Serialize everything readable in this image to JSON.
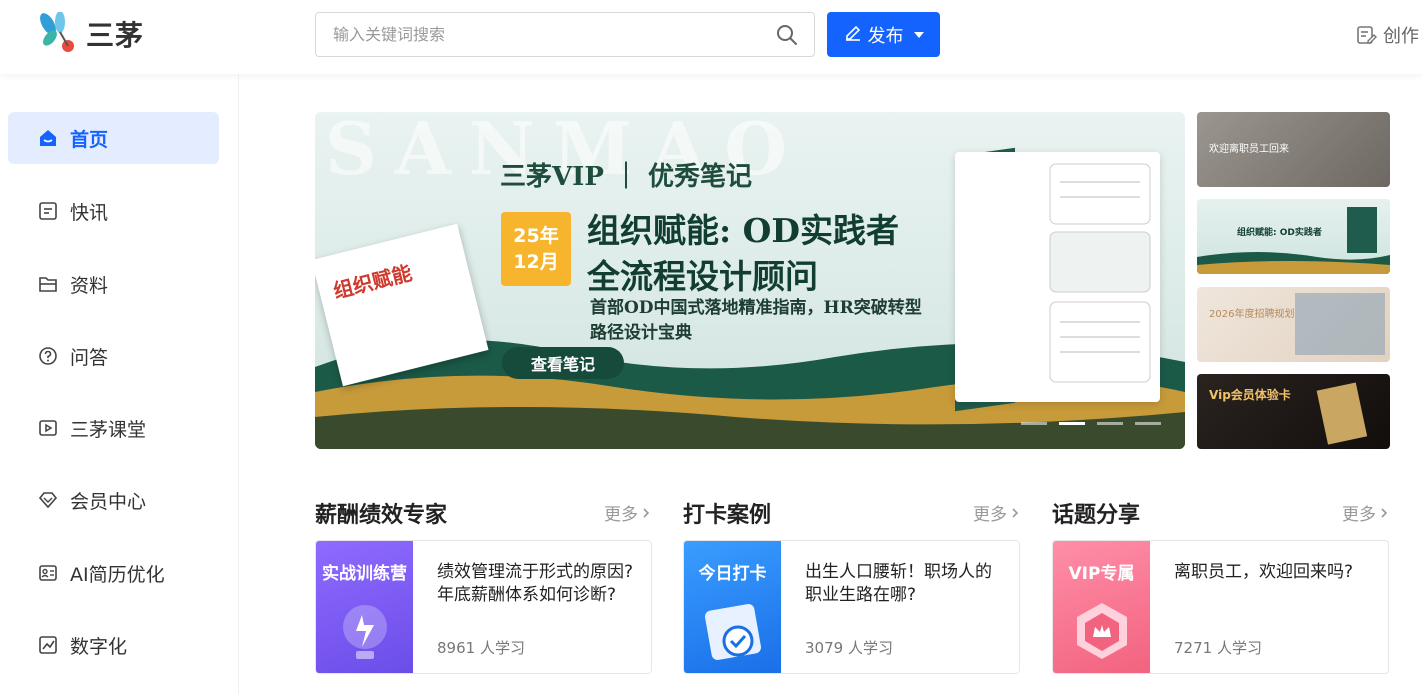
{
  "header": {
    "logo_text": "三茅",
    "search_placeholder": "输入关键词搜索",
    "publish_label": "发布",
    "create_label": "创作"
  },
  "sidebar": {
    "items": [
      {
        "label": "首页",
        "icon": "home-icon",
        "active": true
      },
      {
        "label": "快讯",
        "icon": "news-icon"
      },
      {
        "label": "资料",
        "icon": "folder-icon"
      },
      {
        "label": "问答",
        "icon": "question-icon"
      },
      {
        "label": "三茅课堂",
        "icon": "play-icon"
      },
      {
        "label": "会员中心",
        "icon": "diamond-icon"
      },
      {
        "label": "AI简历优化",
        "icon": "resume-icon"
      },
      {
        "label": "数字化",
        "icon": "chart-icon"
      }
    ]
  },
  "banner": {
    "subtitle": "三茅VIP ｜ 优秀笔记",
    "badge_year": "25年",
    "badge_month": "12月",
    "title_line1": "组织赋能: OD实践者",
    "title_line2": "全流程设计顾问",
    "desc_line1": "首部OD中国式落地精准指南，HR突破转型",
    "desc_line2": "路径设计宝典",
    "button": "查看笔记",
    "book_title": "组织赋能"
  },
  "thumbs": [
    {
      "text": "欢迎离职员工回来"
    },
    {
      "text": "组织赋能: OD实践者"
    },
    {
      "text": "2026年度招聘规划"
    },
    {
      "text": "Vip会员体验卡"
    }
  ],
  "sections": [
    {
      "title": "薪酬绩效专家",
      "more": "更多",
      "card": {
        "image_label": "实战训练营",
        "title": "绩效管理流于形式的原因?年底薪酬体系如何诊断?",
        "count": "8961 人学习"
      }
    },
    {
      "title": "打卡案例",
      "more": "更多",
      "card": {
        "image_label": "今日打卡",
        "title": "出生人口腰斩！职场人的职业生路在哪?",
        "count": "3079 人学习"
      }
    },
    {
      "title": "话题分享",
      "more": "更多",
      "card": {
        "image_label": "VIP专属",
        "title": "离职员工，欢迎回来吗?",
        "count": "7271 人学习"
      }
    }
  ],
  "colors": {
    "accent": "#1463ff",
    "active_bg": "#e3edff"
  }
}
